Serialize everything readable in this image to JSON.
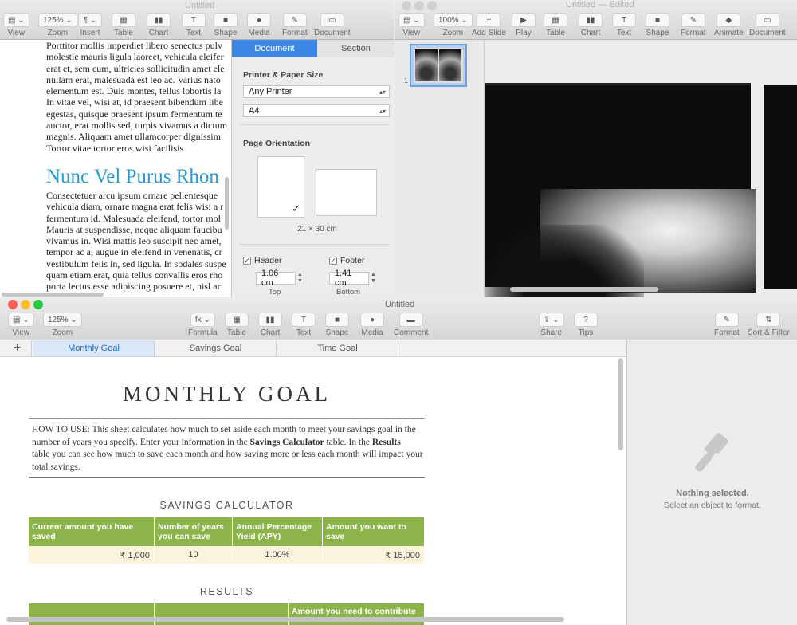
{
  "pages": {
    "title": "Untitled",
    "toolbar": [
      {
        "icon": "view-icon",
        "label": "View",
        "glyph": "▤ ⌄"
      },
      {
        "icon": "zoom-icon",
        "label": "Zoom",
        "glyph": "125% ⌄"
      },
      {
        "icon": "insert-icon",
        "label": "Insert",
        "glyph": "¶ ⌄"
      },
      {
        "icon": "table-icon",
        "label": "Table",
        "glyph": "▦"
      },
      {
        "icon": "chart-icon",
        "label": "Chart",
        "glyph": "▮▮"
      },
      {
        "icon": "text-icon",
        "label": "Text",
        "glyph": "T"
      },
      {
        "icon": "shape-icon",
        "label": "Shape",
        "glyph": "■"
      },
      {
        "icon": "media-icon",
        "label": "Media",
        "glyph": "●"
      },
      {
        "icon": "format-icon",
        "label": "Format",
        "glyph": "✎"
      },
      {
        "icon": "document-icon",
        "label": "Document",
        "glyph": "▭"
      }
    ],
    "body_lines_top": [
      "Porttitor mollis imperdiet libero senectus pulv",
      "molestie mauris ligula laoreet, vehicula eleifer",
      "erat et, sem cum, ultricies sollicitudin amet ele",
      "nullam erat, malesuada est leo ac. Varius nato",
      "elementum est. Duis montes, tellus lobortis la",
      "In vitae vel, wisi at, id praesent bibendum libe",
      "egestas, quisque praesent ipsum fermentum te",
      "auctor, erat mollis sed, turpis vivamus a dictum",
      "magnis. Aliquam amet ullamcorper dignissim",
      "Tortor vitae tortor eros wisi facilisis."
    ],
    "heading": "Nunc Vel Purus Rhon",
    "body_lines_bottom": [
      "Consectetuer arcu ipsum ornare pellentesque",
      "vehicula diam, ornare magna erat felis wisi a r",
      "fermentum id. Malesuada eleifend, tortor mol",
      "Mauris at suspendisse, neque aliquam faucibu",
      "vivamus in. Wisi mattis leo suscipit nec amet,",
      "tempor ac a, augue in eleifend in venenatis, cr",
      "vestibulum felis in, sed ligula. In sodales suspe",
      "quam etiam erat, quia tellus convallis eros rho",
      "porta lectus esse adipiscing posuere et, nisl ar"
    ],
    "inspector": {
      "tabs": [
        "Document",
        "Section"
      ],
      "printer_heading": "Printer & Paper Size",
      "printer": "Any Printer",
      "paper": "A4",
      "orientation_heading": "Page Orientation",
      "check": "✓",
      "size": "21 × 30 cm",
      "header_label": "Header",
      "footer_label": "Footer",
      "header_value": "1.06 cm",
      "footer_value": "1.41 cm",
      "top_label": "Top",
      "bottom_label": "Bottom"
    }
  },
  "keynote": {
    "title": "Untitled — Edited",
    "toolbar": [
      {
        "icon": "view-icon",
        "label": "View",
        "glyph": "▤ ⌄"
      },
      {
        "icon": "zoom-icon",
        "label": "Zoom",
        "glyph": "100% ⌄"
      },
      {
        "icon": "add-slide-icon",
        "label": "Add Slide",
        "glyph": "+"
      },
      {
        "icon": "play-icon",
        "label": "Play",
        "glyph": "▶"
      },
      {
        "icon": "table-icon",
        "label": "Table",
        "glyph": "▦"
      },
      {
        "icon": "chart-icon",
        "label": "Chart",
        "glyph": "▮▮"
      },
      {
        "icon": "text-icon",
        "label": "Text",
        "glyph": "T"
      },
      {
        "icon": "shape-icon",
        "label": "Shape",
        "glyph": "■"
      },
      {
        "icon": "format-icon",
        "label": "Format",
        "glyph": "✎"
      },
      {
        "icon": "animate-icon",
        "label": "Animate",
        "glyph": "◆"
      },
      {
        "icon": "document-icon",
        "label": "Document",
        "glyph": "▭"
      }
    ],
    "slide_number": "1"
  },
  "numbers": {
    "title": "Untitled",
    "toolbar_left": [
      {
        "icon": "view-icon",
        "label": "View",
        "glyph": "▤ ⌄"
      },
      {
        "icon": "zoom-icon",
        "label": "Zoom",
        "glyph": "125% ⌄"
      }
    ],
    "toolbar_mid": [
      {
        "icon": "formula-icon",
        "label": "Formula",
        "glyph": "fx ⌄"
      },
      {
        "icon": "table-icon",
        "label": "Table",
        "glyph": "▦"
      },
      {
        "icon": "chart-icon",
        "label": "Chart",
        "glyph": "▮▮"
      },
      {
        "icon": "text-icon",
        "label": "Text",
        "glyph": "T"
      },
      {
        "icon": "shape-icon",
        "label": "Shape",
        "glyph": "■"
      },
      {
        "icon": "media-icon",
        "label": "Media",
        "glyph": "●"
      },
      {
        "icon": "comment-icon",
        "label": "Comment",
        "glyph": "▬"
      }
    ],
    "toolbar_right": [
      {
        "icon": "share-icon",
        "label": "Share",
        "glyph": "⇪ ⌄"
      },
      {
        "icon": "tips-icon",
        "label": "Tips",
        "glyph": "?"
      },
      {
        "icon": "format-icon",
        "label": "Format",
        "glyph": "✎"
      },
      {
        "icon": "sort-filter-icon",
        "label": "Sort & Filter",
        "glyph": "⇅"
      }
    ],
    "add_sheet": "+",
    "sheets": [
      "Monthly Goal",
      "Savings Goal",
      "Time Goal"
    ],
    "sheet_title": "MONTHLY GOAL",
    "howto_line1": "HOW TO USE: This sheet calculates how much to set aside each month to meet your savings goal in the",
    "howto_line2a": "number of years you specify. Enter your information in the ",
    "howto_b1": "Savings Calculator",
    "howto_line2b": " table. In the ",
    "howto_b2": "Results",
    "howto_line3": "table you can see how much to save each month and how saving more or less each month will impact your",
    "howto_line4": "total savings.",
    "calc_title": "SAVINGS CALCULATOR",
    "calc_headers": [
      "Current amount you have saved",
      "Number of years you can save",
      "Annual Percentage Yield (APY)",
      "Amount you want to save"
    ],
    "calc_values": [
      "₹ 1,000",
      "10",
      "1.00%",
      "₹ 15,000"
    ],
    "results_title": "RESULTS",
    "results_header": "Amount you need to contribute",
    "nothing_selected": "Nothing selected.",
    "select_hint": "Select an object to format."
  }
}
